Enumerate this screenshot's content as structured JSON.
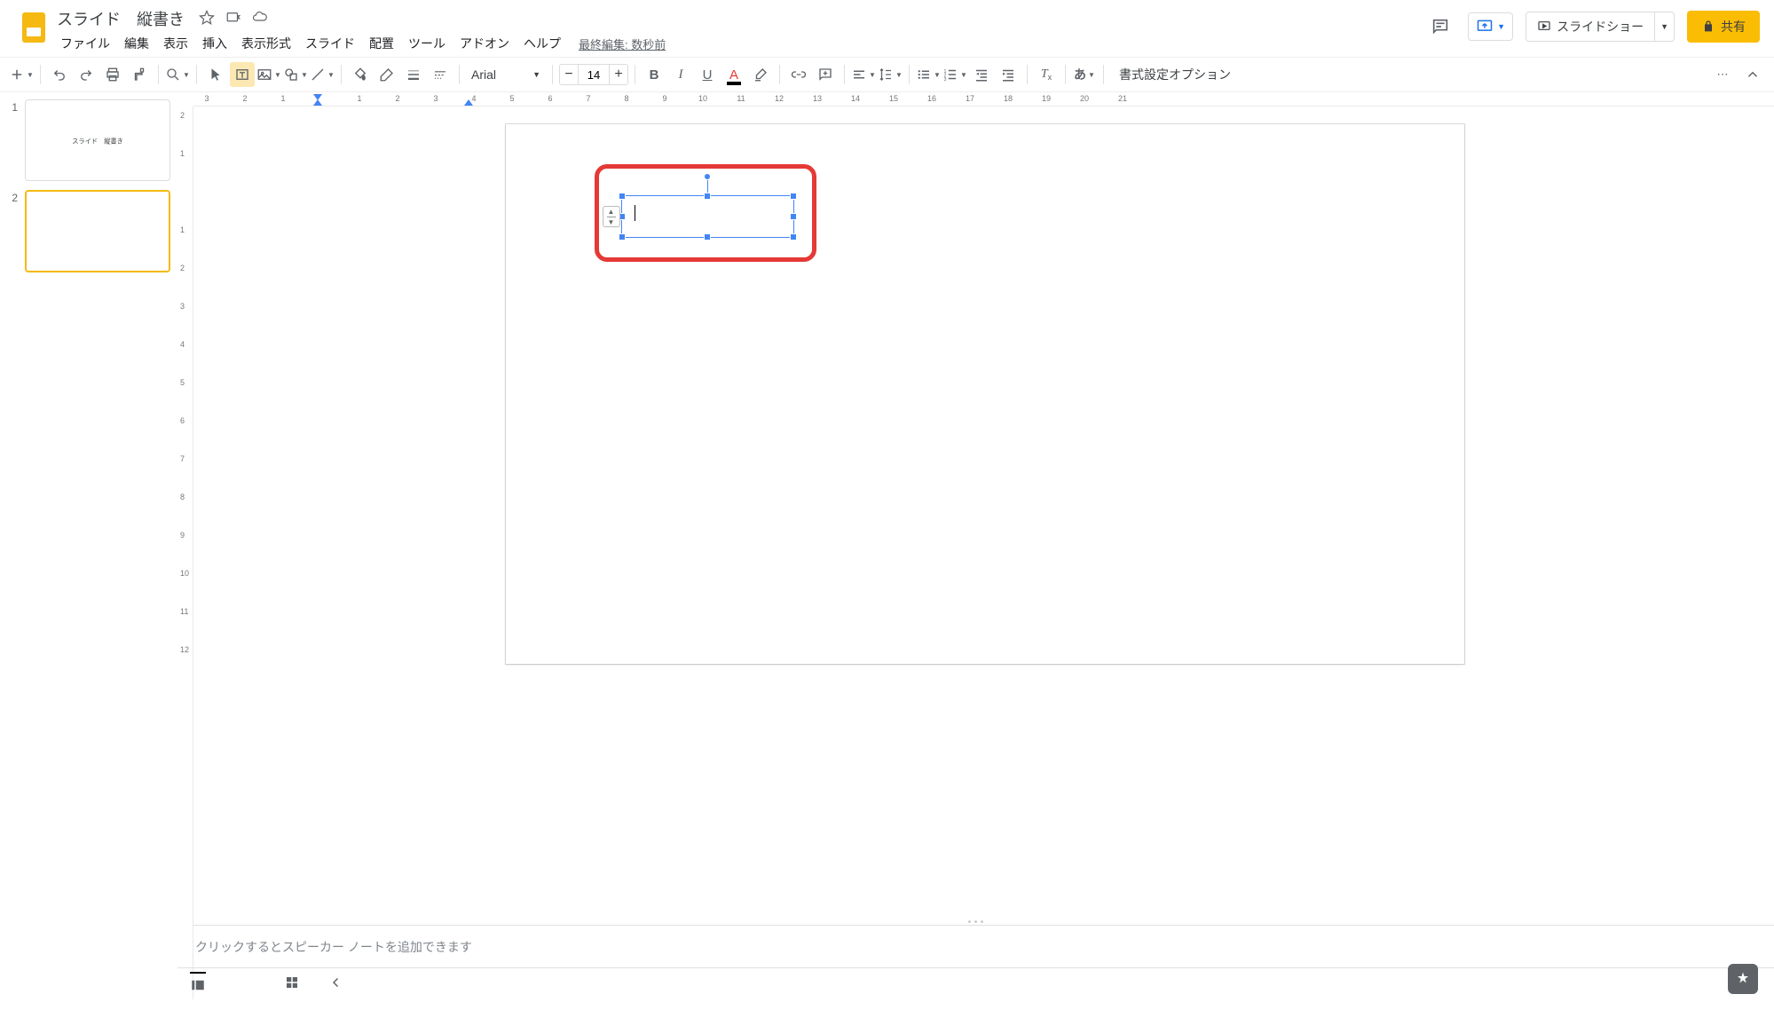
{
  "header": {
    "doc_title": "スライド　縦書き",
    "last_edit": "最終編集: 数秒前",
    "present_button": "スライドショー",
    "share_button": "共有"
  },
  "menu": {
    "items": [
      "ファイル",
      "編集",
      "表示",
      "挿入",
      "表示形式",
      "スライド",
      "配置",
      "ツール",
      "アドオン",
      "ヘルプ"
    ]
  },
  "toolbar": {
    "font_name": "Arial",
    "font_size": "14",
    "format_options": "書式設定オプション",
    "ja_input": "あ"
  },
  "filmstrip": {
    "slides": [
      {
        "num": "1",
        "text": "スライド　縦書き",
        "selected": false
      },
      {
        "num": "2",
        "text": "",
        "selected": true
      }
    ]
  },
  "ruler": {
    "h_labels": [
      "3",
      "2",
      "1",
      "",
      "1",
      "2",
      "3",
      "4",
      "5",
      "6",
      "7",
      "8",
      "9",
      "10",
      "11",
      "12",
      "13",
      "14",
      "15",
      "16",
      "17",
      "18",
      "19",
      "20",
      "21"
    ],
    "v_labels": [
      "2",
      "1",
      "",
      "1",
      "2",
      "3",
      "4",
      "5",
      "6",
      "7",
      "8",
      "9",
      "10",
      "11",
      "12"
    ]
  },
  "speaker_notes": {
    "placeholder": "クリックするとスピーカー ノートを追加できます"
  }
}
